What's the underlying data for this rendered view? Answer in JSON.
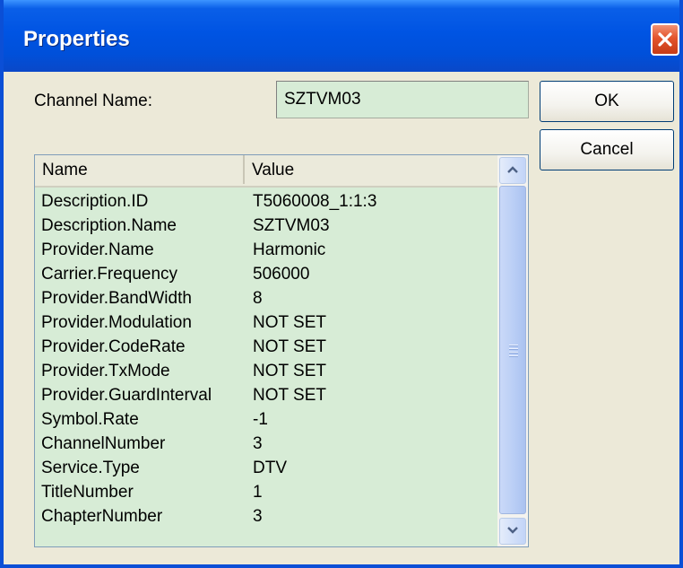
{
  "window": {
    "title": "Properties"
  },
  "form": {
    "channel_label": "Channel Name:",
    "channel_value": "SZTVM03"
  },
  "buttons": {
    "ok": "OK",
    "cancel": "Cancel"
  },
  "list": {
    "columns": [
      "Name",
      "Value"
    ],
    "rows": [
      {
        "name": "Description.ID",
        "value": "T5060008_1:1:3"
      },
      {
        "name": "Description.Name",
        "value": "SZTVM03"
      },
      {
        "name": "Provider.Name",
        "value": "Harmonic"
      },
      {
        "name": "Carrier.Frequency",
        "value": "506000"
      },
      {
        "name": "Provider.BandWidth",
        "value": "8"
      },
      {
        "name": "Provider.Modulation",
        "value": "NOT SET"
      },
      {
        "name": "Provider.CodeRate",
        "value": "NOT SET"
      },
      {
        "name": "Provider.TxMode",
        "value": "NOT SET"
      },
      {
        "name": "Provider.GuardInterval",
        "value": "NOT SET"
      },
      {
        "name": "Symbol.Rate",
        "value": "-1"
      },
      {
        "name": "ChannelNumber",
        "value": "3"
      },
      {
        "name": "Service.Type",
        "value": "DTV"
      },
      {
        "name": "TitleNumber",
        "value": "1"
      },
      {
        "name": "ChapterNumber",
        "value": "3"
      }
    ]
  },
  "icons": {
    "close": "close-icon",
    "scroll_up": "chevron-up-icon",
    "scroll_down": "chevron-down-icon",
    "grip": "scrollbar-grip-icon"
  },
  "colors": {
    "titlebar": "#0054e3",
    "dialog_bg": "#ece9d8",
    "field_bg": "#d7ecd6",
    "close_button": "#e3542d"
  }
}
